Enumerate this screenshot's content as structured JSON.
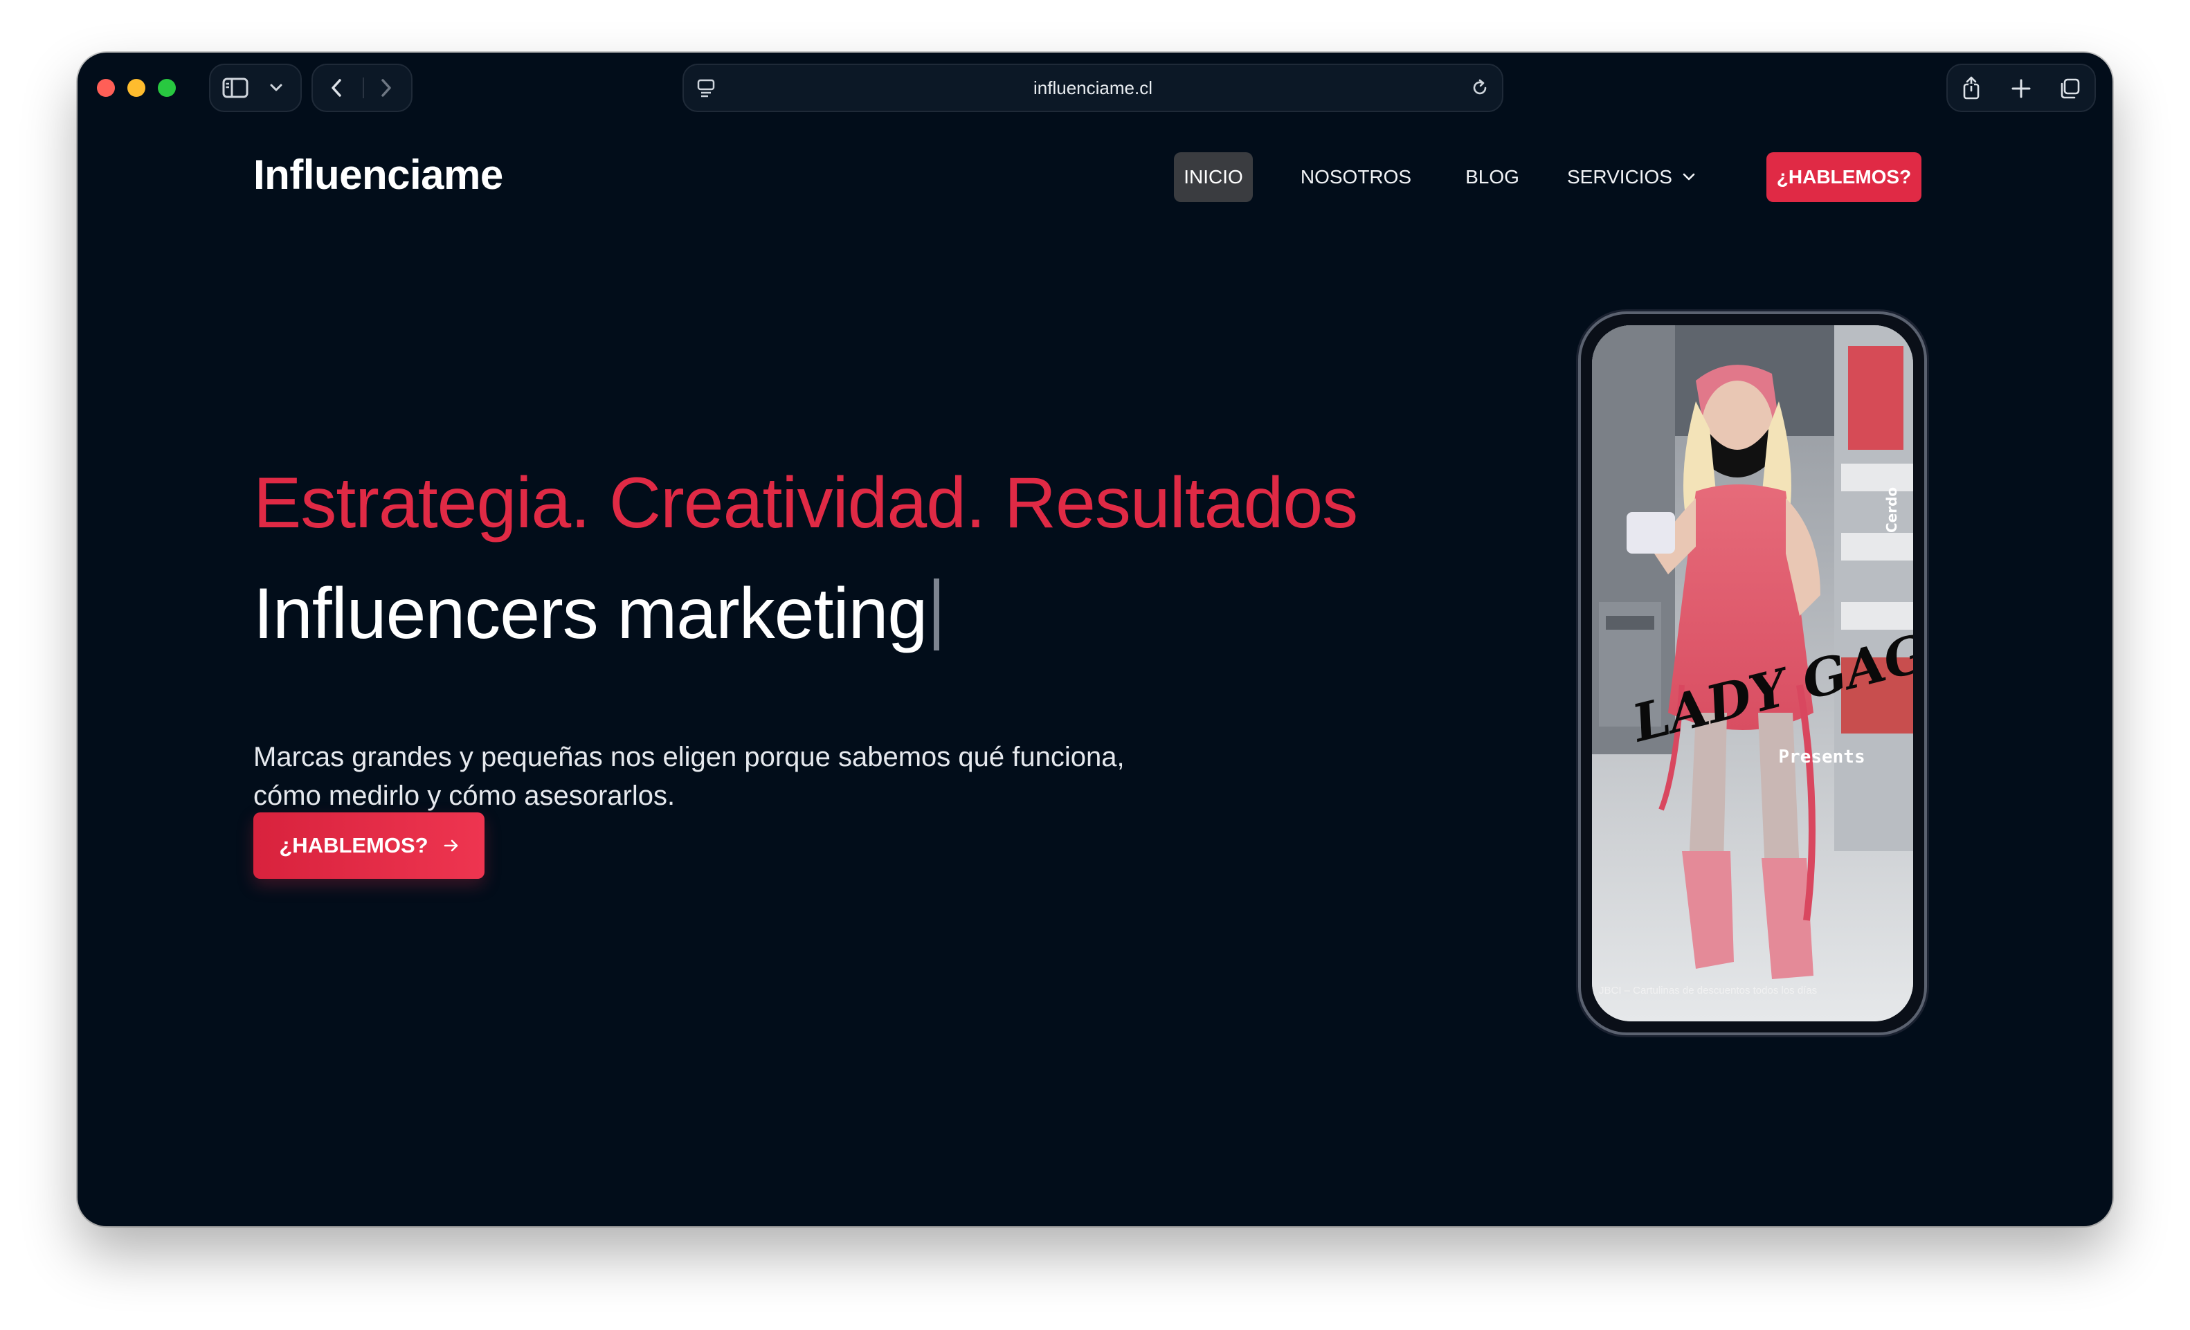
{
  "browser": {
    "url": "influenciame.cl",
    "traffic_colors": {
      "close": "#ff5f57",
      "minimize": "#febc2e",
      "zoom": "#28c840"
    }
  },
  "site": {
    "brand": "Influenciame",
    "nav": [
      {
        "label": "INICIO",
        "active": true
      },
      {
        "label": "NOSOTROS",
        "active": false
      },
      {
        "label": "BLOG",
        "active": false
      },
      {
        "label": "SERVICIOS",
        "active": false,
        "has_dropdown": true
      }
    ],
    "nav_cta": "¿HABLEMOS?"
  },
  "hero": {
    "tagline": "Estrategia. Creatividad. Resultados",
    "headline": "Influencers marketing",
    "description_lines": [
      "Marcas grandes y pequeñas nos eligen porque sabemos qué funciona,",
      "cómo medirlo y cómo asesorarlos."
    ],
    "cta": "¿HABLEMOS?"
  },
  "phone_video": {
    "overlay_title": "LADY GAGA",
    "overlay_subtitle": "Presents",
    "side_text": "Cerdo",
    "caption": "JBCI – Cartulinas de descuentos todos los días"
  },
  "colors": {
    "background": "#020d1a",
    "accent": "#e02a45",
    "text": "#ffffff"
  },
  "icons": {
    "sidebar": "sidebar-icon",
    "back": "chevron-left-icon",
    "forward": "chevron-right-icon",
    "reload": "reload-icon",
    "share": "share-icon",
    "new_tab": "plus-icon",
    "tabs": "tabs-icon",
    "arrow": "arrow-right-icon"
  }
}
